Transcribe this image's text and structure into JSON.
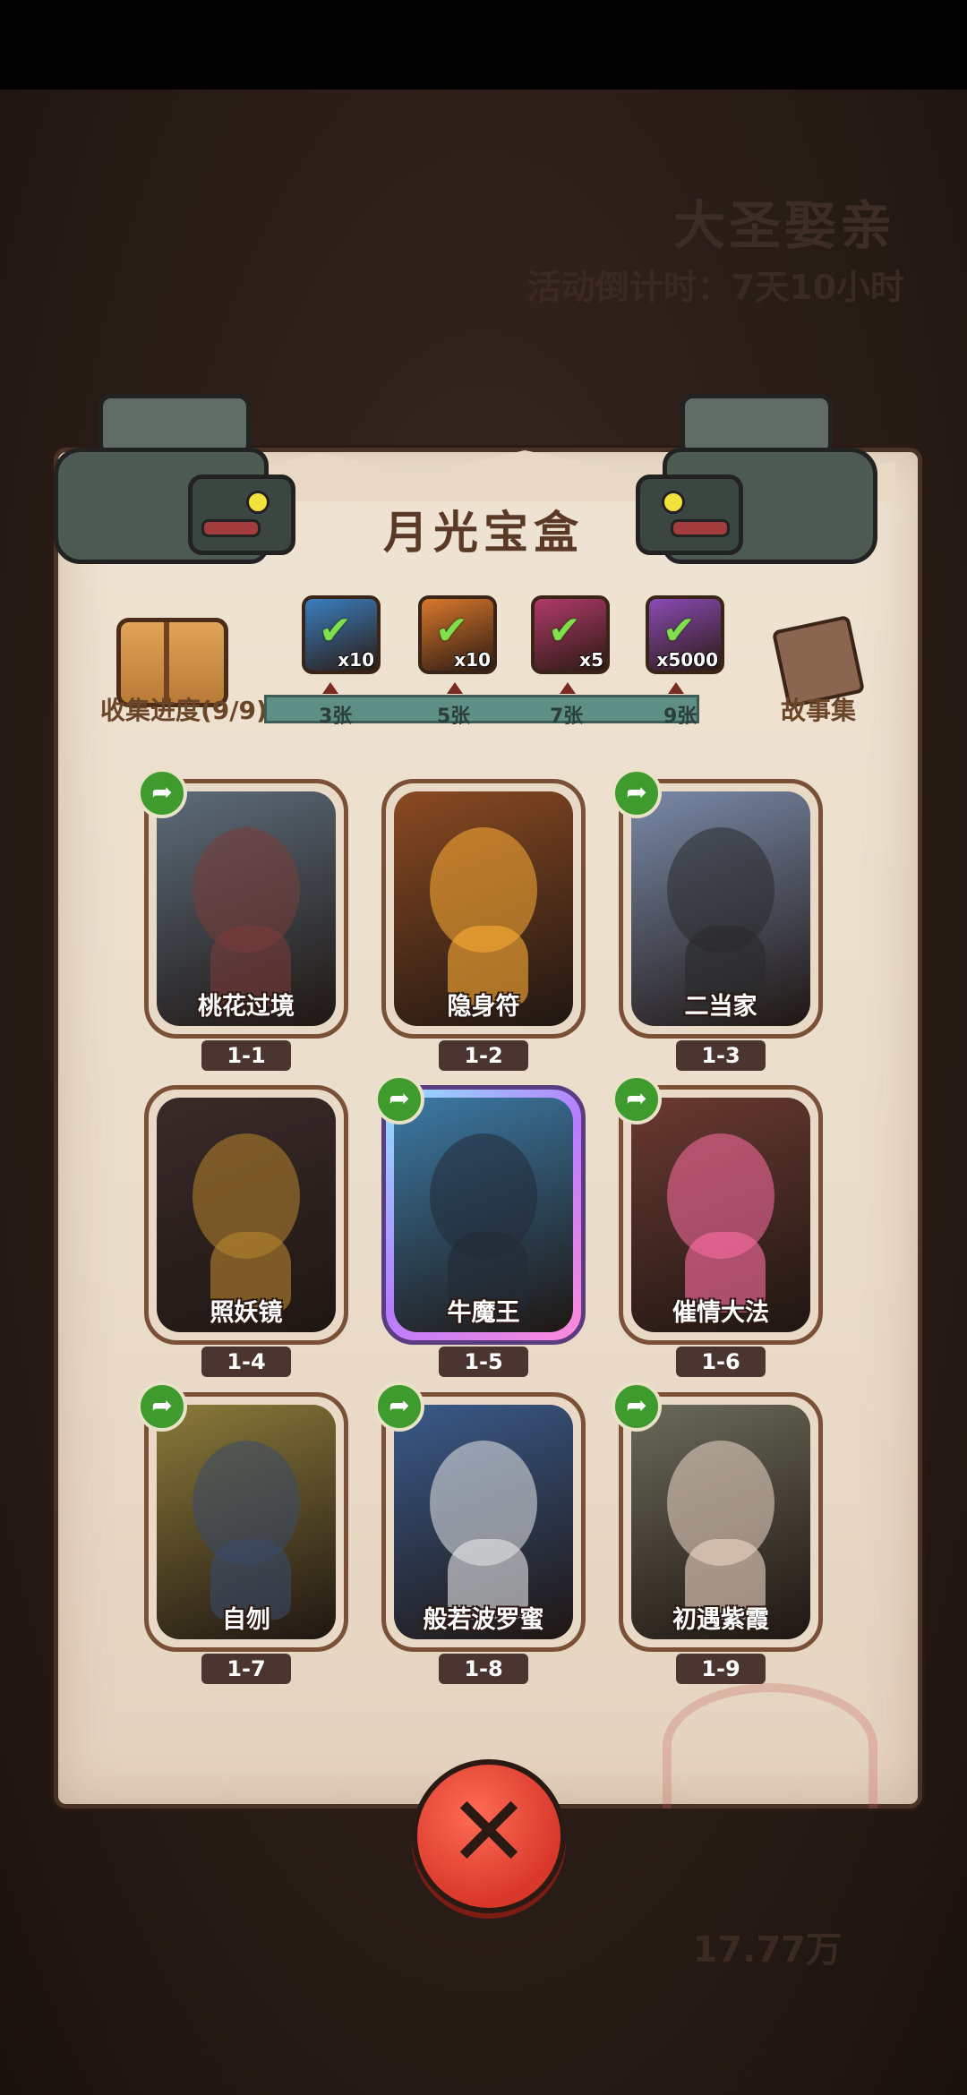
{
  "background": {
    "event_title": "大圣娶亲",
    "event_timer": "活动倒计时：7天10小时",
    "coin_amount": "17.77万"
  },
  "panel": {
    "title": "月光宝盒",
    "progress_label": "收集进度(9/9)",
    "story_label": "故事集",
    "rewards": [
      {
        "icon": "treasure-chest-icon",
        "qty": "x10",
        "color": "#3a7fc0",
        "claimed": true
      },
      {
        "icon": "key-icon",
        "qty": "x10",
        "color": "#d9782c",
        "claimed": true
      },
      {
        "icon": "gem-icon",
        "qty": "x5",
        "color": "#b03a6a",
        "claimed": true
      },
      {
        "icon": "gold-ingot-icon",
        "qty": "x5000",
        "color": "#8a4bb5",
        "claimed": true
      }
    ],
    "milestones": [
      "3张",
      "5张",
      "7张",
      "9张"
    ]
  },
  "cards": [
    {
      "name": "桃花过境",
      "num": "1-1",
      "share": true,
      "art_bg": "#5d6c7a",
      "art_fg": "#7a3c3a",
      "rare": false
    },
    {
      "name": "隐身符",
      "num": "1-2",
      "share": false,
      "art_bg": "#8a4a22",
      "art_fg": "#ffae35",
      "rare": false
    },
    {
      "name": "二当家",
      "num": "1-3",
      "share": true,
      "art_bg": "#7a8aa8",
      "art_fg": "#2a2a2a",
      "rare": false
    },
    {
      "name": "照妖镜",
      "num": "1-4",
      "share": false,
      "art_bg": "#3a2a2a",
      "art_fg": "#b8862e",
      "rare": false
    },
    {
      "name": "牛魔王",
      "num": "1-5",
      "share": true,
      "art_bg": "#3c7aa5",
      "art_fg": "#232a36",
      "rare": true
    },
    {
      "name": "催情大法",
      "num": "1-6",
      "share": true,
      "art_bg": "#6a3a32",
      "art_fg": "#ff6fa5",
      "rare": false
    },
    {
      "name": "自刎",
      "num": "1-7",
      "share": true,
      "art_bg": "#8a7a3a",
      "art_fg": "#3a4a6a",
      "rare": false
    },
    {
      "name": "般若波罗蜜",
      "num": "1-8",
      "share": true,
      "art_bg": "#3a5a8a",
      "art_fg": "#e8e8e8",
      "rare": false
    },
    {
      "name": "初遇紫霞",
      "num": "1-9",
      "share": true,
      "art_bg": "#6a6a5a",
      "art_fg": "#f0d8c8",
      "rare": false
    }
  ],
  "close_icon": "close-x-icon"
}
